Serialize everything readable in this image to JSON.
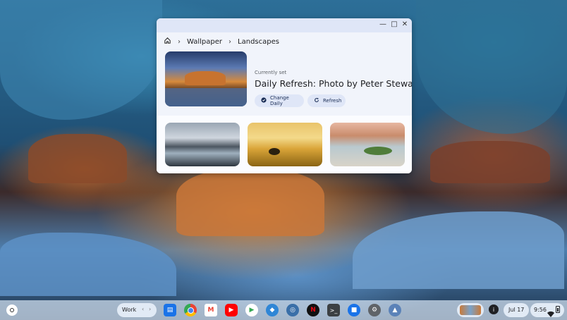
{
  "window": {
    "breadcrumb": [
      "Wallpaper",
      "Landscapes"
    ],
    "currently_set_label": "Currently set",
    "current_title": "Daily Refresh: Photo by Peter Stewart",
    "change_daily_label": "Change Daily",
    "refresh_label": "Refresh",
    "thumbnails": [
      "mountain-lake",
      "sunset-beach",
      "rocky-shore"
    ]
  },
  "shelf": {
    "desk_label": "Work",
    "date": "Jul 17",
    "time": "9:56",
    "apps": [
      "files",
      "chrome",
      "gmail",
      "youtube",
      "play-store",
      "app-6",
      "app-7",
      "netflix",
      "terminal",
      "messages",
      "settings",
      "app-12"
    ]
  }
}
